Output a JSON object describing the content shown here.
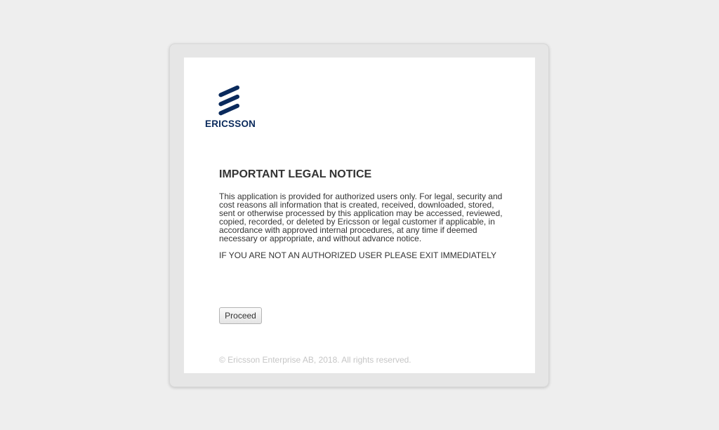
{
  "brand": {
    "name": "ERICSSON",
    "logo_icon": "ericsson-logo-icon",
    "color": "#0a2a5c"
  },
  "notice": {
    "title": "IMPORTANT LEGAL NOTICE",
    "body": "This application is provided for authorized users only. For legal, security and cost reasons all information that is created, received, downloaded, stored, sent or otherwise processed by this application may be accessed, reviewed, copied, recorded, or deleted by Ericsson or legal customer if applicable, in accordance with approved internal procedures, at any time if deemed necessary or appropriate, and without advance notice.",
    "warning": "IF YOU ARE NOT AN AUTHORIZED USER PLEASE EXIT IMMEDIATELY"
  },
  "actions": {
    "proceed_label": "Proceed"
  },
  "footer": {
    "copyright": "© Ericsson Enterprise AB, 2018. All rights reserved."
  }
}
